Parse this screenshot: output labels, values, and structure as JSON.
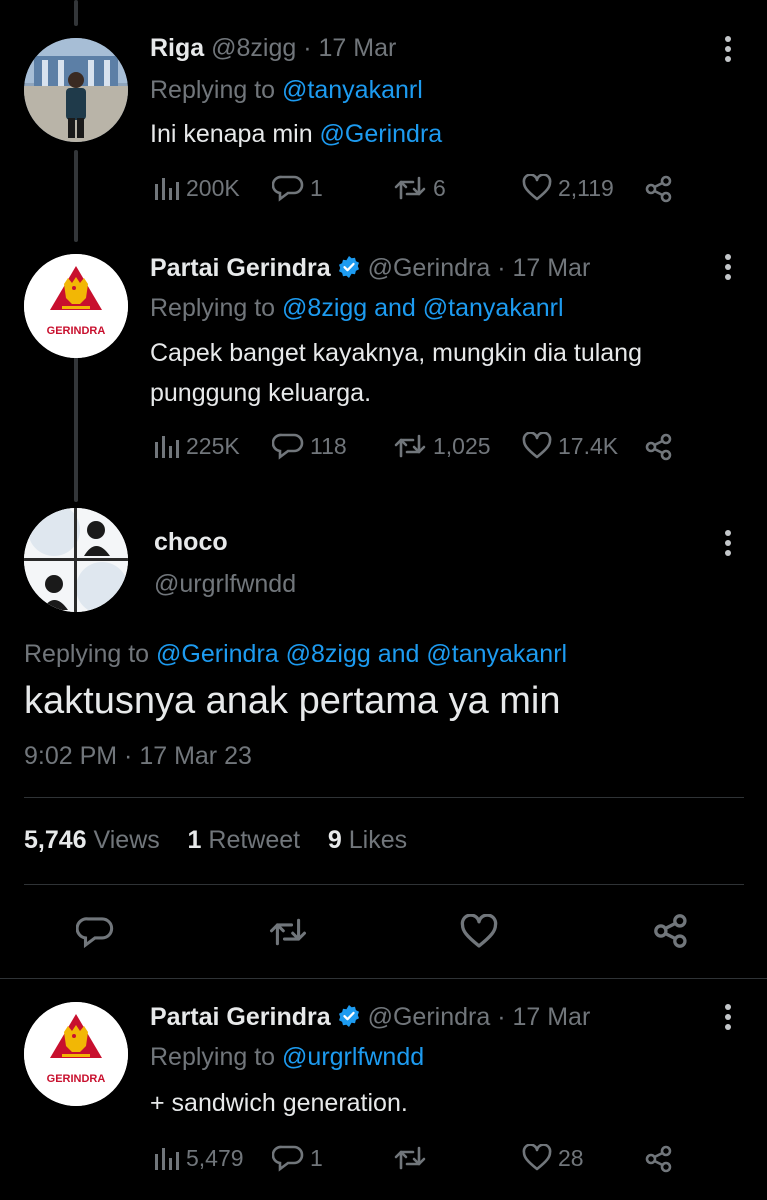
{
  "tweet1": {
    "name": "Riga",
    "handle": "@8zigg",
    "date": "· 17 Mar",
    "replying_prefix": "Replying to ",
    "replying_to": "@tanyakanrl",
    "text_prefix": "Ini kenapa min ",
    "text_mention": "@Gerindra",
    "views": "200K",
    "replies": "1",
    "retweets": "6",
    "likes": "2,119"
  },
  "tweet2": {
    "name": "Partai Gerindra",
    "handle": "@Gerindra",
    "date": "· 17 Mar",
    "replying_prefix": "Replying to ",
    "replying_to": "@8zigg and @tanyakanrl",
    "text_line1": "Capek banget kayaknya, mungkin dia tulang",
    "text_line2": "punggung keluarga.",
    "views": "225K",
    "replies": "118",
    "retweets": "1,025",
    "likes": "17.4K",
    "logo_text": "GERINDRA"
  },
  "main_tweet": {
    "name": "choco",
    "handle": "@urgrlfwndd",
    "replying_prefix": "Replying to ",
    "replying_to": "@Gerindra @8zigg and @tanyakanrl",
    "text": "kaktusnya anak pertama ya min",
    "timestamp": "9:02 PM · 17 Mar 23",
    "views_count": "5,746",
    "views_label": " Views",
    "retweets_count": "1",
    "retweets_label": " Retweet",
    "likes_count": "9",
    "likes_label": " Likes"
  },
  "tweet3": {
    "name": "Partai Gerindra",
    "handle": "@Gerindra",
    "date": "· 17 Mar",
    "replying_prefix": "Replying to ",
    "replying_to": "@urgrlfwndd",
    "text": "+ sandwich generation.",
    "views": "5,479",
    "replies": "1",
    "likes": "28",
    "logo_text": "GERINDRA"
  },
  "colors": {
    "background": "#000000",
    "text": "#e7e9ea",
    "muted": "#71767b",
    "link": "#1d9bf0",
    "logo_red": "#c8102e",
    "logo_gold": "#f2b705"
  }
}
